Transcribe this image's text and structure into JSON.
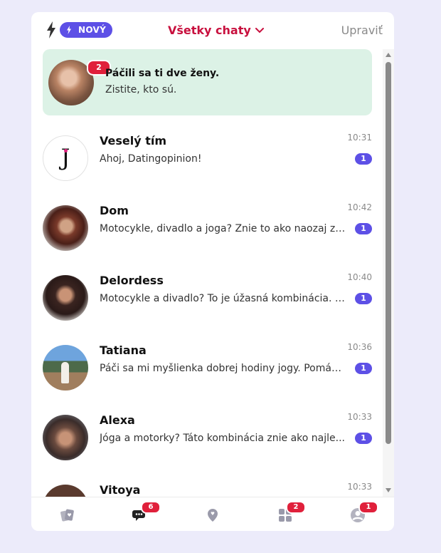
{
  "header": {
    "new_badge": "NOVÝ",
    "filter_label": "Všetky chaty",
    "edit_label": "Upraviť"
  },
  "likes_banner": {
    "count": "2",
    "title": "Páčili sa ti dve ženy.",
    "subtitle": "Zistite, kto sú."
  },
  "chats": [
    {
      "name": "Veselý tím",
      "time": "10:31",
      "message": "Ahoj, Datingopinion!",
      "unread": "1",
      "avatar_letter": "J"
    },
    {
      "name": "Dom",
      "time": "10:42",
      "message": "Motocykle, divadlo a joga? Znie to ako naozaj za...",
      "unread": "1"
    },
    {
      "name": "Delordess",
      "time": "10:40",
      "message": "Motocykle a divadlo? To je úžasná kombinácia. A...",
      "unread": "1"
    },
    {
      "name": "Tatiana",
      "time": "10:36",
      "message": "Páči sa mi myšlienka dobrej hodiny jogy. Pomáh...",
      "unread": "1"
    },
    {
      "name": "Alexa",
      "time": "10:33",
      "message": "Jóga a motorky? Táto kombinácia znie ako najle...",
      "unread": "1"
    },
    {
      "name": "Vitoya",
      "time": "10:33",
      "message": "",
      "unread": ""
    }
  ],
  "nav": {
    "chats_badge": "6",
    "apps_badge": "2",
    "profile_badge": "1"
  },
  "colors": {
    "accent": "#5d50e6",
    "filter_red": "#c8103e",
    "badge_red": "#e0203b",
    "likes_bg": "#dcf2e6",
    "page_bg": "#ecebfa"
  },
  "icons": [
    "bolt-icon",
    "chevron-down-icon",
    "cards-icon",
    "chat-bubbles-icon",
    "location-pin-icon",
    "grid-icon",
    "profile-icon"
  ]
}
